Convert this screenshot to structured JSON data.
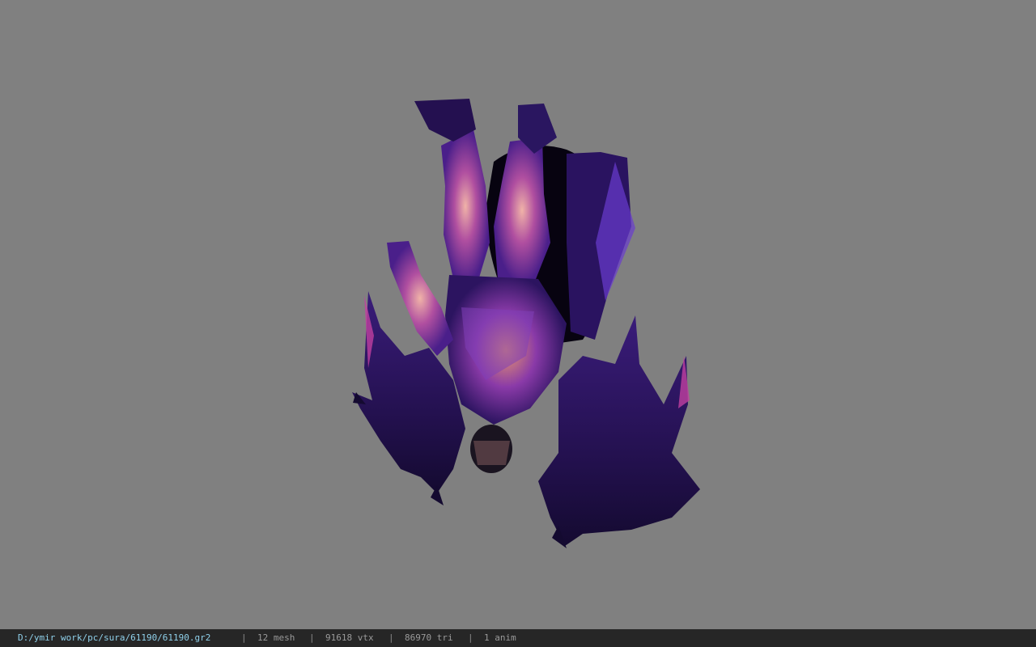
{
  "status": {
    "file_path": "D:/ymir work/pc/sura/61190/61190.gr2",
    "separator": "|",
    "mesh": "12 mesh",
    "vtx": "91618 vtx",
    "tri": "86970 tri",
    "anim": "1 anim"
  },
  "colors": {
    "background": "#808080",
    "status_bar": "#262626",
    "path_text": "#8fd0ea",
    "stat_text": "#9a9a9a",
    "model_dark": "#1a0f3a",
    "model_purple": "#5b2ca8",
    "model_glow": "#e0a0a0"
  },
  "icons": {
    "model": "3d-character-model"
  }
}
